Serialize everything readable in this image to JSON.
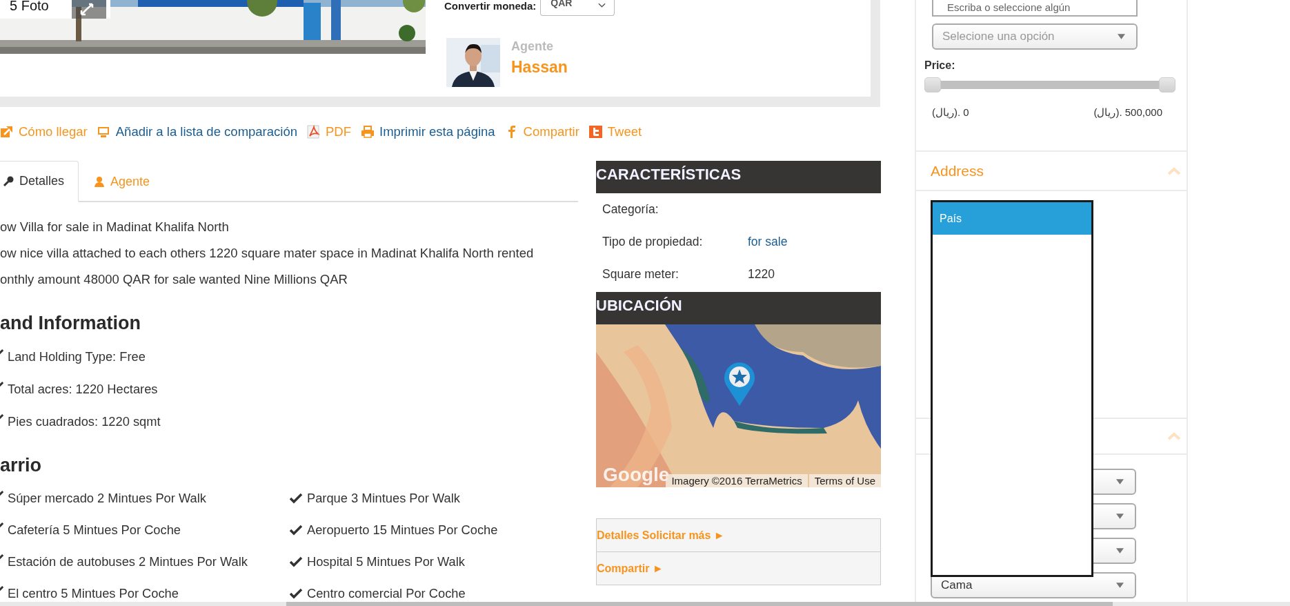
{
  "top_card": {
    "photo_count": "5 Foto",
    "currency": {
      "label": "Convertir moneda:",
      "value": "QAR"
    },
    "agent": {
      "label": "Agente",
      "name": "Hassan"
    }
  },
  "actions": [
    {
      "label": "Cómo llegar",
      "kind": "directions",
      "color": "#f7941d"
    },
    {
      "label": "Añadir a la lista de comparación",
      "kind": "compare",
      "color": "#1b5d91"
    },
    {
      "label": "PDF",
      "kind": "pdf",
      "color": "#f7941d"
    },
    {
      "label": "Imprimir esta página",
      "kind": "print",
      "color": "#1b5d91"
    },
    {
      "label": "Compartir",
      "kind": "share",
      "color": "#f7941d"
    },
    {
      "label": "Tweet",
      "kind": "tweet",
      "color": "#f7941d"
    }
  ],
  "tabs": [
    {
      "label": "Detalles",
      "kind": "key",
      "selected": true
    },
    {
      "label": "Agente",
      "kind": "person",
      "selected": false
    }
  ],
  "description": [
    "ow Villa for sale in Madinat Khalifa North",
    "ow nice villa attached to each others 1220 square mater space in Madinat Khalifa North rented",
    "onthly amount 48000 QAR for sale wanted Nine Millions QAR"
  ],
  "land_information": {
    "heading": "and Information",
    "items": [
      "Land Holding Type: Free",
      "Total acres: 1220 Hectares",
      "Pies cuadrados: 1220 sqmt"
    ]
  },
  "neighborhood": {
    "heading": "arrio",
    "items": [
      "Súper mercado 2 Mintues Por Walk",
      "Parque 3 Mintues Por Walk",
      "Cafetería 5 Mintues Por Coche",
      "Aeropuerto 15 Mintues Por Coche",
      "Estación de autobuses 2 Mintues Por Walk",
      "Hospital 5 Mintues Por Walk",
      "El centro 5 Mintues Por Coche",
      "Centro comercial Por Coche"
    ]
  },
  "characteristics": {
    "heading": "CARACTERÍSTICAS",
    "rows": [
      {
        "label": "Categoría:"
      },
      {
        "label": "Tipo de propiedad:",
        "value": "for sale",
        "kind": "link"
      },
      {
        "label": "Square meter:",
        "value": "1220",
        "kind": "text"
      }
    ]
  },
  "location": {
    "heading": "UBICACIÓN",
    "map": {
      "kind": "picture",
      "logo": "Google",
      "attribution": "Imagery ©2016 TerraMetrics",
      "terms": "Terms of Use"
    }
  },
  "more_links": [
    "Detalles Solicitar más ►",
    "Compartir ►"
  ],
  "sidebar": {
    "search_field": {
      "placeholder": "Escriba o seleccione algún"
    },
    "select": {
      "placeholder": "Selecione una opción"
    },
    "price": {
      "label": "Price:",
      "thumbs": [
        {
          "level": 0
        },
        {
          "level": 1
        }
      ],
      "min_label": "(ريال). 0",
      "max_label": "(ريال). 500,000"
    },
    "address": {
      "title": "Address",
      "expanded": true,
      "dropdown": {
        "options": [
          {
            "label": "País",
            "selected": true
          }
        ]
      }
    },
    "second_section": {
      "expanded": true,
      "selects": [
        {
          "kind": "select"
        },
        {
          "kind": "select"
        },
        {
          "kind": "select"
        },
        {
          "kind": "select",
          "value": "Cama"
        }
      ]
    }
  }
}
